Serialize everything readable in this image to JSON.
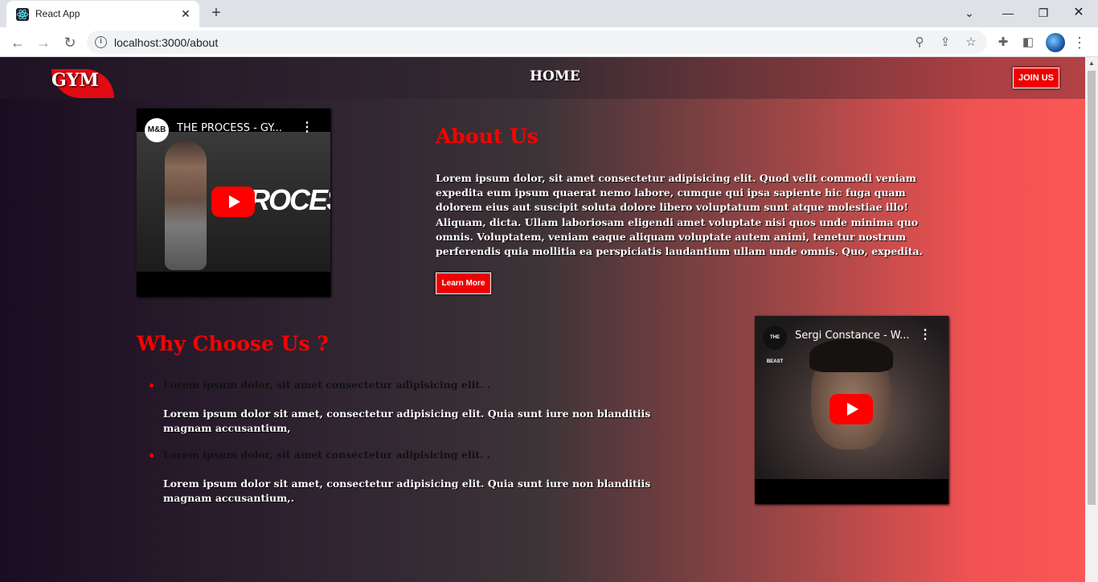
{
  "browser": {
    "tab_title": "React App",
    "tab_close": "✕",
    "new_tab": "+",
    "url": "localhost:3000/about",
    "icons": [
      "react-favicon",
      "close-icon",
      "plus-icon",
      "chevron-down-icon",
      "minimize-icon",
      "maximize-icon",
      "window-close-icon",
      "back-arrow-icon",
      "forward-arrow-icon",
      "reload-icon",
      "info-icon",
      "zoom-icon",
      "share-icon",
      "star-icon",
      "extensions-icon",
      "side-panel-icon",
      "profile-avatar",
      "menu-kebab-icon"
    ]
  },
  "site": {
    "logo": "GYM",
    "nav_home": "HOME",
    "join_button": "JOIN US",
    "colors": {
      "accent": "#ff0000",
      "button": "#ee0000",
      "gradient_start": "#1c0c22",
      "gradient_end": "#fb5656"
    }
  },
  "about": {
    "video_title": "THE PROCESS - GY...",
    "video_channel": "M&B",
    "video_overlay": "PROCESS",
    "title": "About Us",
    "text": "Lorem ipsum dolor, sit amet consectetur adipisicing elit. Quod velit commodi veniam expedita eum ipsum quaerat nemo labore, cumque qui ipsa sapiente hic fuga quam dolorem eius aut suscipit soluta dolore libero voluptatum sunt atque molestiae illo! Aliquam, dicta. Ullam laboriosam eligendi amet voluptate nisi quos unde minima quo omnis. Voluptatem, veniam eaque aliquam voluptate autem animi, tenetur nostrum perferendis quia mollitia ea perspiciatis laudantium ullam unde omnis. Quo, expedita.",
    "learn_more": "Learn More"
  },
  "why": {
    "title": "Why Choose Us ?",
    "items": [
      {
        "head": "Lorem ipsum dolor, sit amet consectetur adipisicing elit. .",
        "desc": "Lorem ipsum dolor sit amet, consectetur adipisicing elit. Quia sunt iure non blanditiis magnam accusantium,"
      },
      {
        "head": "Lorem ipsum dolor, sit amet consectetur adipisicing elit. .",
        "desc": "Lorem ipsum dolor sit amet, consectetur adipisicing elit. Quia sunt iure non blanditiis magnam accusantium,."
      }
    ],
    "video_title": "Sergi Constance - W...",
    "video_channel": "THE BEAST"
  }
}
